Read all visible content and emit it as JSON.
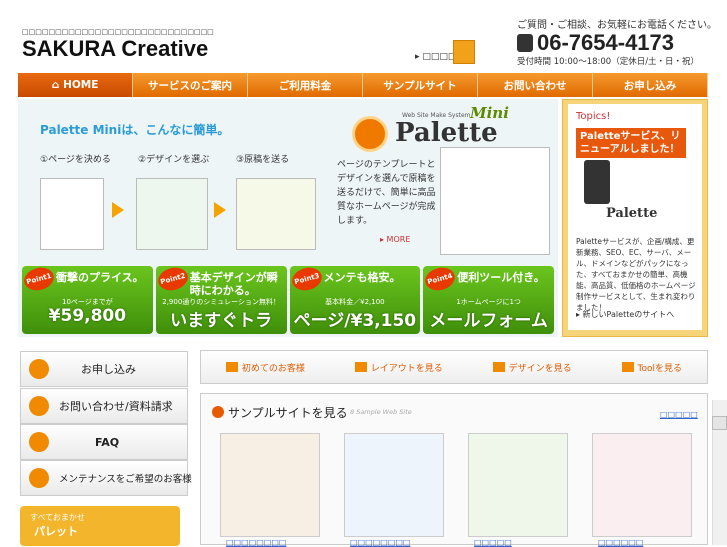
{
  "header": {
    "tagline": "□□□□□□□□□□□□□□□□□□□□□□□□□□□□□",
    "logo": "SAKURA Creative",
    "company_link": "▸ □□□□",
    "contact_text": "ご質問・ご相談、お気軽にお電話ください。",
    "phone": "06-7654-4173",
    "hours": "受付時間 10:00～18:00（定休日/土・日・祝）"
  },
  "nav": {
    "items": [
      "HOME",
      "サービスのご案内",
      "ご利用料金",
      "サンプルサイト",
      "お問い合わせ",
      "お申し込み"
    ]
  },
  "hero": {
    "title": "Palette Miniは、こんなに簡単。",
    "steps": [
      "①ページを決める",
      "②デザインを選ぶ",
      "③原稿を送る"
    ],
    "logo_small": "Web Site Make System",
    "logo_mini": "Mini",
    "logo_word": "Palette",
    "description": "ページのテンプレートとデザインを選んで原稿を送るだけで、簡単に高品質なホームページが完成します。",
    "more": "▸ MORE",
    "points": [
      {
        "badge": "Point1",
        "headline": "衝撃のプライス。",
        "sub": "10ページまでが",
        "big": "¥59,800"
      },
      {
        "badge": "Point2",
        "headline": "基本デザインが瞬時にわかる。",
        "sub": "2,900通りのシミュレーション無料！",
        "big": "いますぐトライ！"
      },
      {
        "badge": "Point3",
        "headline": "メンテも格安。",
        "sub": "基本料金／¥2,100",
        "big": "ページ/¥3,150"
      },
      {
        "badge": "Point4",
        "headline": "便利ツール付き。",
        "sub": "1ホームページに1つ",
        "big": "メールフォーム無料"
      }
    ]
  },
  "topics": {
    "heading": "Topics!",
    "banner": "Paletteサービス、リニューアルしました！",
    "logo": "Palette",
    "description": "Paletteサービスが、企画/構成、更新業務、SEO、EC、サーバ、メール、ドメインなどがパックになった、すべておまかせの簡単、高機能、高品質、低価格のホームページ制作サービスとして、生まれ変わりました！",
    "link": "▸ 新しいPaletteのサイトへ"
  },
  "sidebar": {
    "items": [
      {
        "label": "お申し込み"
      },
      {
        "label": "お問い合わせ/資料請求"
      },
      {
        "label": "FAQ"
      },
      {
        "label": "メンテナンスをご希望のお客様"
      }
    ],
    "bottom_small": "すべておまかせ",
    "bottom_big": "パレット"
  },
  "subnav": {
    "items": [
      "初めてのお客様",
      "レイアウトを見る",
      "デザインを見る",
      "Toolを見る"
    ]
  },
  "samples": {
    "heading": "サンプルサイトを見る",
    "sub": "8 Sample Web Site",
    "more": "□□□□□",
    "labels": [
      "□□□□□□□□",
      "□□□□□□□□",
      "□□□□□",
      "□□□□□□"
    ]
  },
  "colors": {
    "accent": "#e06a00",
    "nav_orange": "#f59a2e",
    "point_green": "#4fa612",
    "topics_gold": "#f6d57a",
    "link_blue": "#3366cc"
  }
}
